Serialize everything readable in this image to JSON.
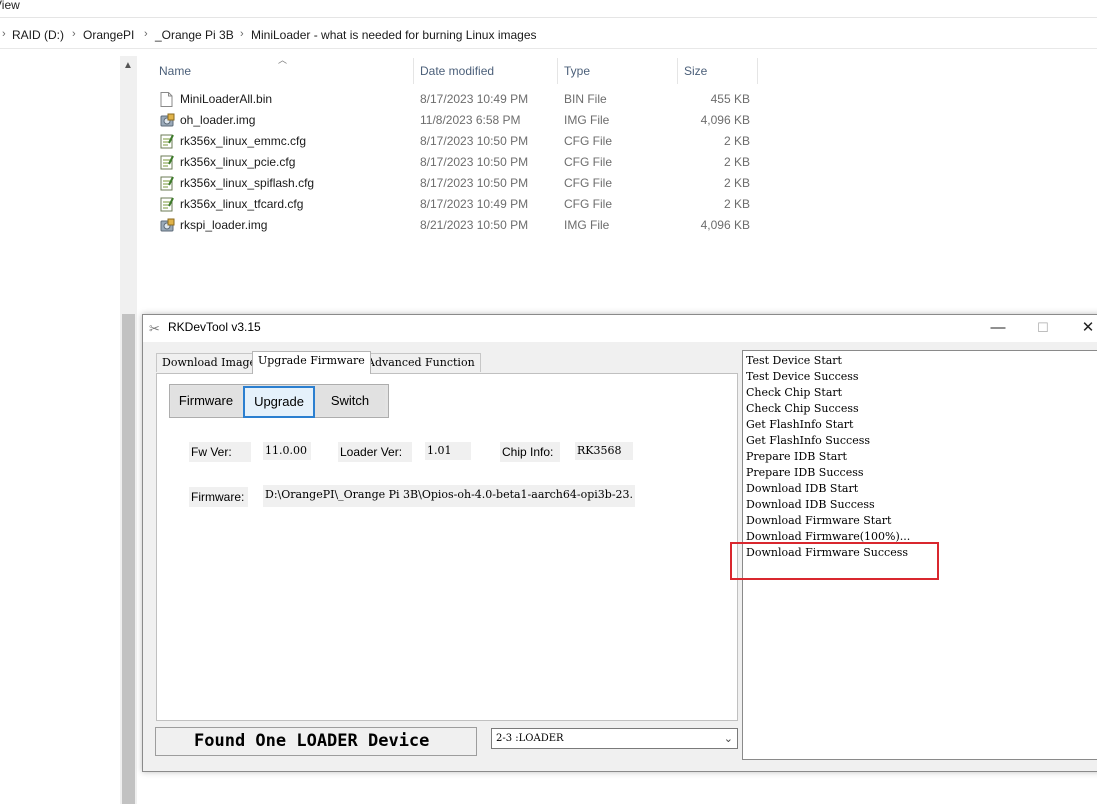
{
  "explorer": {
    "ribbon_tab": "View",
    "breadcrumbs": [
      "RAID (D:)",
      "OrangePI",
      "_Orange Pi 3B",
      "MiniLoader - what is needed for burning Linux images"
    ],
    "columns": {
      "name": "Name",
      "date": "Date modified",
      "type": "Type",
      "size": "Size"
    },
    "files": [
      {
        "name": "MiniLoaderAll.bin",
        "date": "8/17/2023 10:49 PM",
        "type": "BIN File",
        "size": "455 KB",
        "icon": "file-icon"
      },
      {
        "name": "oh_loader.img",
        "date": "11/8/2023 6:58 PM",
        "type": "IMG File",
        "size": "4,096 KB",
        "icon": "disk-image-icon"
      },
      {
        "name": "rk356x_linux_emmc.cfg",
        "date": "8/17/2023 10:50 PM",
        "type": "CFG File",
        "size": "2 KB",
        "icon": "config-file-icon"
      },
      {
        "name": "rk356x_linux_pcie.cfg",
        "date": "8/17/2023 10:50 PM",
        "type": "CFG File",
        "size": "2 KB",
        "icon": "config-file-icon"
      },
      {
        "name": "rk356x_linux_spiflash.cfg",
        "date": "8/17/2023 10:50 PM",
        "type": "CFG File",
        "size": "2 KB",
        "icon": "config-file-icon"
      },
      {
        "name": "rk356x_linux_tfcard.cfg",
        "date": "8/17/2023 10:49 PM",
        "type": "CFG File",
        "size": "2 KB",
        "icon": "config-file-icon"
      },
      {
        "name": "rkspi_loader.img",
        "date": "8/21/2023 10:50 PM",
        "type": "IMG File",
        "size": "4,096 KB",
        "icon": "disk-image-icon"
      }
    ]
  },
  "rkdevtool": {
    "title": "RKDevTool v3.15",
    "window_buttons": {
      "minimize": "—",
      "maximize": "☐",
      "close": "✕"
    },
    "tabs": [
      "Download Image",
      "Upgrade Firmware",
      "Advanced Function"
    ],
    "active_tab": "Upgrade Firmware",
    "buttons": {
      "firmware": "Firmware",
      "upgrade": "Upgrade",
      "switch": "Switch"
    },
    "fields": {
      "fw_ver_label": "Fw Ver:",
      "fw_ver_value": "11.0.00",
      "loader_ver_label": "Loader Ver:",
      "loader_ver_value": "1.01",
      "chip_info_label": "Chip Info:",
      "chip_info_value": "RK3568",
      "firmware_label": "Firmware:",
      "firmware_path": "D:\\OrangePI\\_Orange Pi 3B\\Opios-oh-4.0-beta1-aarch64-opi3b-23."
    },
    "status_text": "Found One LOADER Device",
    "device_select": "2-3 :LOADER",
    "log": [
      "Test Device Start",
      "Test Device Success",
      "Check Chip Start",
      " Check Chip Success",
      "Get FlashInfo Start",
      "Get FlashInfo Success",
      "Prepare IDB Start",
      "Prepare IDB Success",
      "Download IDB Start",
      "Download IDB Success",
      "Download Firmware Start",
      "Download Firmware(100%)...",
      "Download Firmware Success"
    ],
    "highlight_color": "#d9272e"
  }
}
